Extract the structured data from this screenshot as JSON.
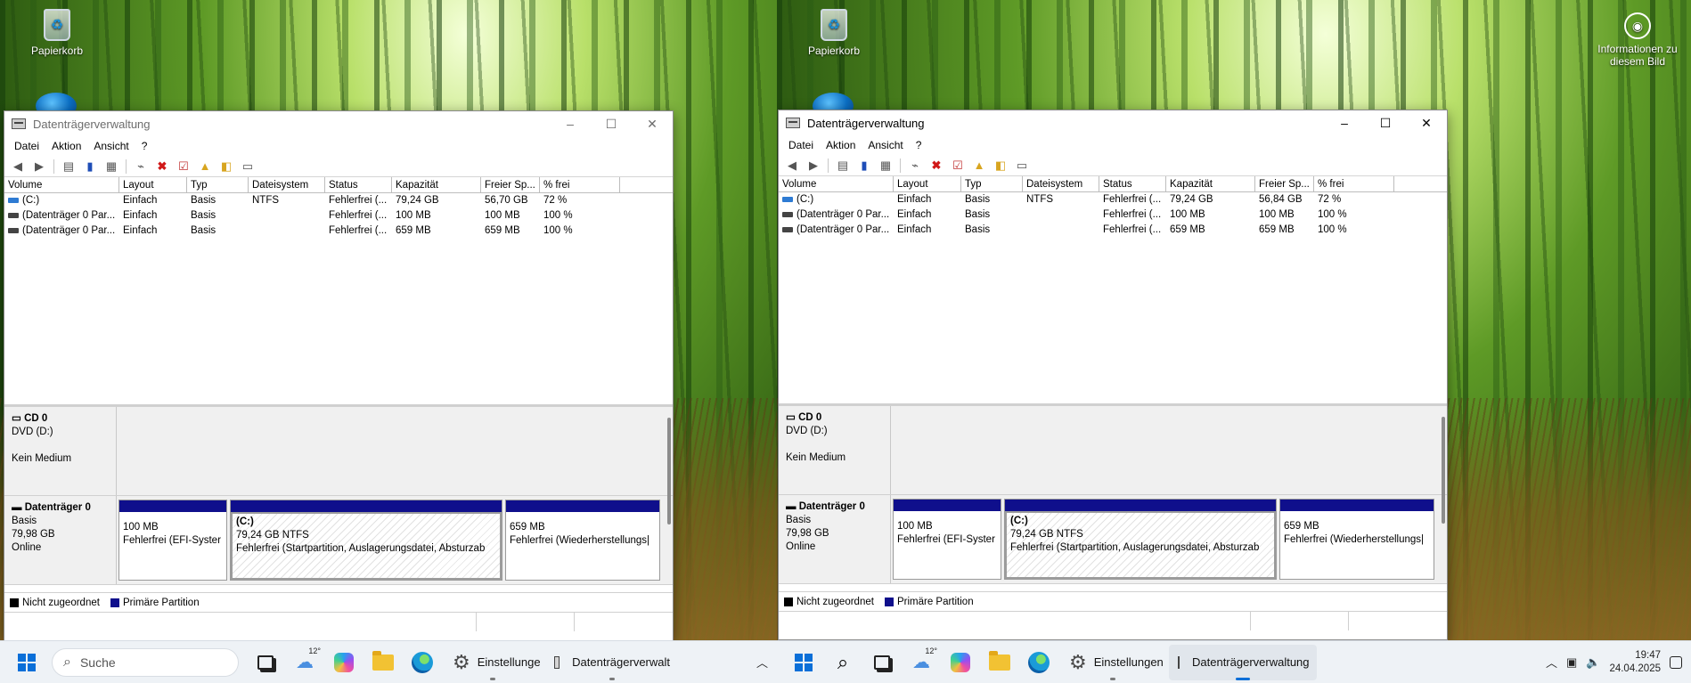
{
  "desktop": {
    "recycle_bin_label": "Papierkorb",
    "info_label": "Informationen zu diesem Bild"
  },
  "window": {
    "title": "Datenträgerverwaltung",
    "controls": {
      "minimize": "–",
      "maximize": "☐",
      "close": "✕"
    },
    "menu": [
      "Datei",
      "Aktion",
      "Ansicht",
      "?"
    ],
    "columns": [
      "Volume",
      "Layout",
      "Typ",
      "Dateisystem",
      "Status",
      "Kapazität",
      "Freier Sp...",
      "% frei"
    ],
    "volumes_left": [
      [
        "(C:)",
        "Einfach",
        "Basis",
        "NTFS",
        "Fehlerfrei (...",
        "79,24 GB",
        "56,70 GB",
        "72 %"
      ],
      [
        "(Datenträger 0 Par...",
        "Einfach",
        "Basis",
        "",
        "Fehlerfrei (...",
        "100 MB",
        "100 MB",
        "100 %"
      ],
      [
        "(Datenträger 0 Par...",
        "Einfach",
        "Basis",
        "",
        "Fehlerfrei (...",
        "659 MB",
        "659 MB",
        "100 %"
      ]
    ],
    "volumes_right": [
      [
        "(C:)",
        "Einfach",
        "Basis",
        "NTFS",
        "Fehlerfrei (...",
        "79,24 GB",
        "56,84 GB",
        "72 %"
      ],
      [
        "(Datenträger 0 Par...",
        "Einfach",
        "Basis",
        "",
        "Fehlerfrei (...",
        "100 MB",
        "100 MB",
        "100 %"
      ],
      [
        "(Datenträger 0 Par...",
        "Einfach",
        "Basis",
        "",
        "Fehlerfrei (...",
        "659 MB",
        "659 MB",
        "100 %"
      ]
    ],
    "cd": {
      "name": "CD 0",
      "line1": "DVD (D:)",
      "line2": "Kein Medium"
    },
    "disk0": {
      "name": "Datenträger 0",
      "type": "Basis",
      "size": "79,98 GB",
      "state": "Online",
      "partitions": [
        {
          "title": "",
          "size": "100 MB",
          "status": "Fehlerfrei (EFI-Syster"
        },
        {
          "title": "(C:)",
          "size": "79,24 GB NTFS",
          "status": "Fehlerfrei (Startpartition, Auslagerungsdatei, Absturzab"
        },
        {
          "title": "",
          "size": "659 MB",
          "status": "Fehlerfrei (Wiederherstellungs|"
        }
      ]
    },
    "legend": [
      {
        "label": "Nicht zugeordnet",
        "color": "#000000"
      },
      {
        "label": "Primäre Partition",
        "color": "#0f0f8c"
      }
    ]
  },
  "taskbar_left": {
    "search_placeholder": "Suche",
    "weather_temp": "12°",
    "settings_label": "Einstellunge",
    "dm_label": "Datenträgerverwalt"
  },
  "taskbar_right": {
    "weather_temp": "12°",
    "settings_label": "Einstellungen",
    "dm_label": "Datenträgerverwaltung",
    "time": "19:47",
    "date": "24.04.2025"
  },
  "colors": {
    "primary_partition": "#0f0f8c",
    "accent": "#0a6fd8"
  }
}
